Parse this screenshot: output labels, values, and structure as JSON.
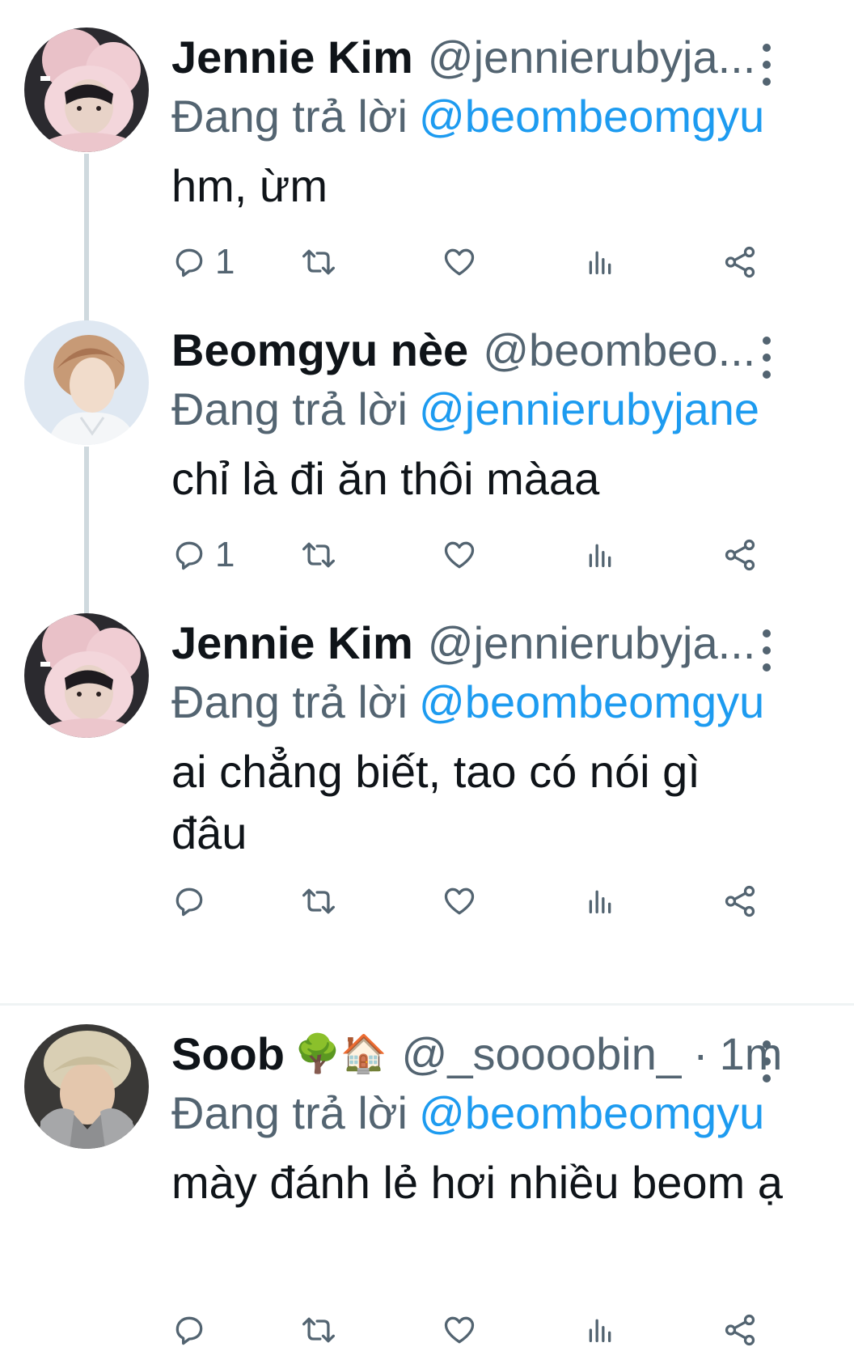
{
  "tweets": [
    {
      "display_name": "Jennie Kim",
      "handle": "@jennierubyja...",
      "reply_prefix": "Đang trả lời",
      "reply_to": "@beombeomgyu",
      "text": "hm, ừm",
      "reply_count": "1",
      "avatar_icon": "avatar-pink-hood"
    },
    {
      "display_name": "Beomgyu nèe",
      "handle": "@beombeo...",
      "reply_prefix": "Đang trả lời",
      "reply_to": "@jennierubyjane",
      "text": "chỉ là đi ăn thôi màaa",
      "reply_count": "1",
      "avatar_icon": "avatar-light-blue"
    },
    {
      "display_name": "Jennie Kim",
      "handle": "@jennierubyja...",
      "reply_prefix": "Đang trả lời",
      "reply_to": "@beombeomgyu",
      "text": "ai chẳng biết, tao có nói gì đâu",
      "reply_count": "",
      "avatar_icon": "avatar-pink-hood"
    },
    {
      "display_name": "Soob",
      "emoji": "🌳🏠",
      "handle": "@_soooobin_",
      "time_sep": "·",
      "time": "1m",
      "reply_prefix": "Đang trả lời",
      "reply_to": "@beombeomgyu",
      "text": "mày đánh lẻ hơi nhiều beom ạ",
      "reply_count": "",
      "avatar_icon": "avatar-grey-hood"
    }
  ],
  "icons": {
    "reply": "reply-icon",
    "retweet": "retweet-icon",
    "like": "like-icon",
    "views": "views-icon",
    "share": "share-icon",
    "more": "more-icon"
  },
  "colors": {
    "link": "#1d9bf0",
    "secondary_text": "#536471",
    "thread_line": "#cfd9de",
    "divider": "#eff3f4"
  }
}
